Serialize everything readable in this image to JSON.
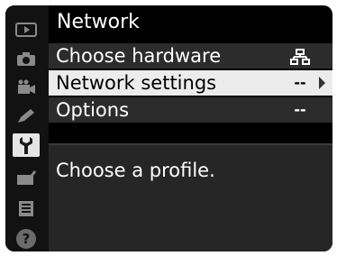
{
  "menu": {
    "title": "Network",
    "items": [
      {
        "label": "Choose hardware",
        "value": "品",
        "icon": "network-hardware-icon"
      },
      {
        "label": "Network settings",
        "value": "--",
        "selected": true
      },
      {
        "label": "Options",
        "value": "--"
      }
    ],
    "help_text": "Choose a profile."
  },
  "sidebar": {
    "tabs": [
      "playback-icon",
      "camera-icon",
      "video-icon",
      "pencil-icon",
      "wrench-icon",
      "retouch-icon",
      "my-menu-icon",
      "help-icon"
    ],
    "active": "wrench-icon",
    "help_label": "?"
  },
  "colors": {
    "highlight": "#ececec",
    "row": "#2c2c2c",
    "background": "#000000"
  }
}
